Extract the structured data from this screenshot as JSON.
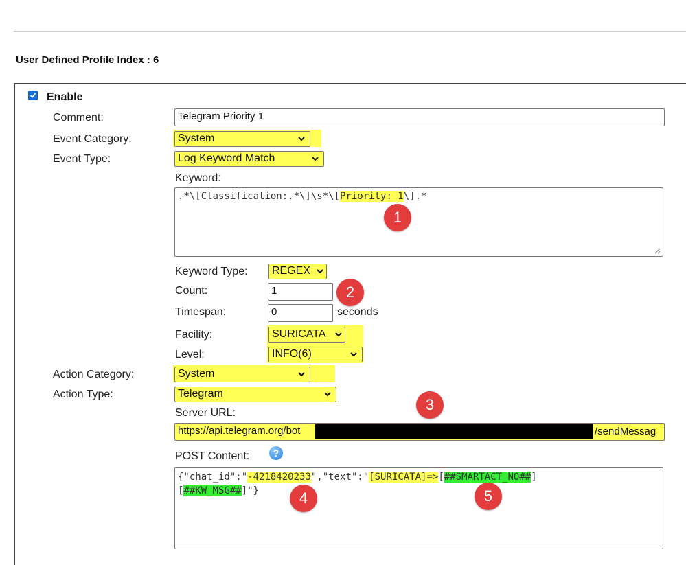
{
  "profile": {
    "index_label": "User Defined Profile Index : 6",
    "enable_label": "Enable",
    "enable_checked": true
  },
  "fields": {
    "comment_label": "Comment:",
    "comment_value": "Telegram Priority 1",
    "event_category_label": "Event Category:",
    "event_category_value": "System",
    "event_type_label": "Event Type:",
    "event_type_value": "Log Keyword Match",
    "keyword_label": "Keyword:",
    "keyword_prefix": ".*\\[Classification:.*\\]\\s*\\[",
    "keyword_highlight": "Priority: 1",
    "keyword_suffix": "\\].*",
    "keyword_type_label": "Keyword Type:",
    "keyword_type_value": "REGEX",
    "count_label": "Count:",
    "count_value": "1",
    "timespan_label": "Timespan:",
    "timespan_value": "0",
    "timespan_unit": "seconds",
    "facility_label": "Facility:",
    "facility_value": "SURICATA",
    "level_label": "Level:",
    "level_value": "INFO(6)",
    "action_category_label": "Action Category:",
    "action_category_value": "System",
    "action_type_label": "Action Type:",
    "action_type_value": "Telegram",
    "server_url_label": "Server URL:",
    "server_url_start": "https://api.telegram.org/bot",
    "server_url_end": "/sendMessag",
    "post_content_label": "POST Content:",
    "post": {
      "part1": "{\"chat_id\":\"",
      "chat_id": "-4218420233",
      "part2": "\",\"text\":\"",
      "tag": "[SURICATA]=>",
      "bracket_open": "[",
      "smartact": "##SMARTACT_NO##",
      "bracket_close": "]",
      "line2_open": "[",
      "kw_msg": "##KW_MSG##",
      "line2_close": "]\"}"
    }
  },
  "annotations": [
    "1",
    "2",
    "3",
    "4",
    "5"
  ],
  "colors": {
    "highlight_yellow": "#ffff55",
    "highlight_green": "#33ee33",
    "badge_red": "#e23c3c",
    "checkbox_blue": "#1a6fd6"
  }
}
